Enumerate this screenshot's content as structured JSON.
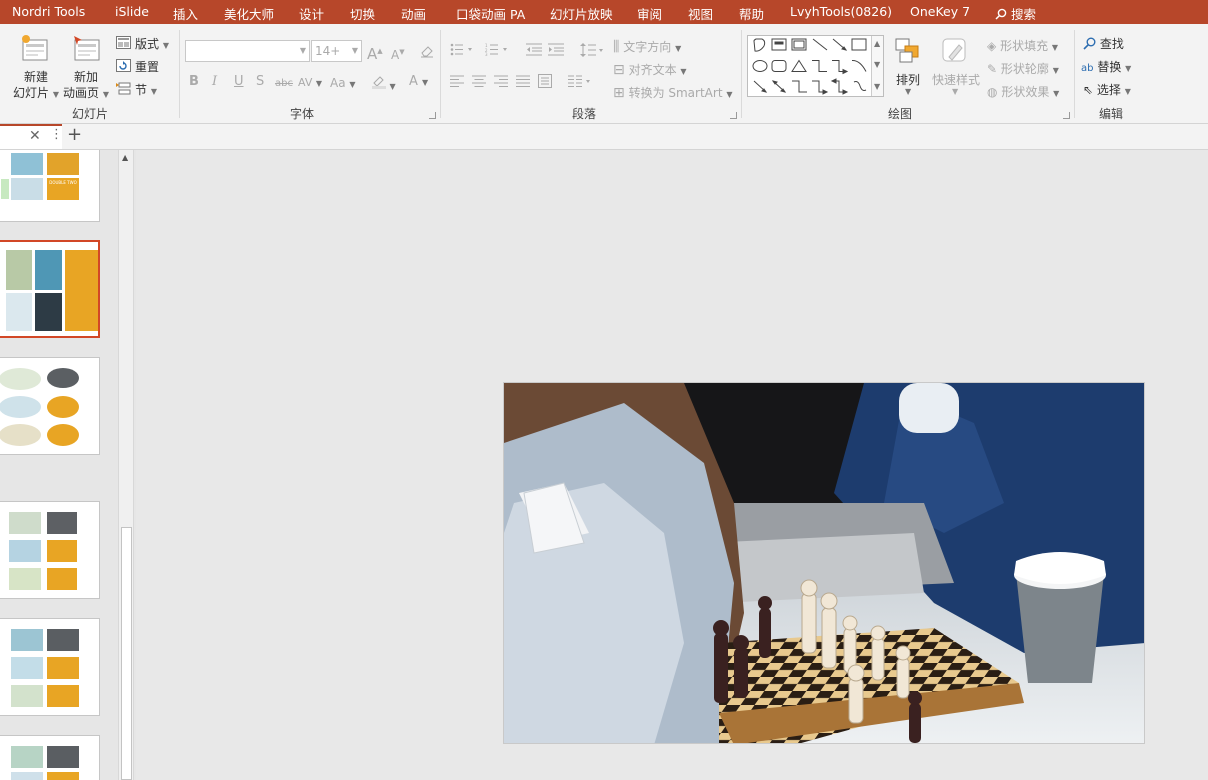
{
  "tabs": [
    "Nordri Tools",
    "iSlide",
    "插入",
    "美化大师",
    "设计",
    "切换",
    "动画",
    "口袋动画 PA",
    "幻灯片放映",
    "审阅",
    "视图",
    "帮助",
    "LvyhTools(0826)",
    "OneKey 7",
    "搜索"
  ],
  "slides_group": {
    "new_slide": [
      "新建",
      "幻灯片"
    ],
    "new_anim": [
      "新加",
      "动画页"
    ],
    "layout": "版式",
    "reset": "重置",
    "section": "节",
    "label": "幻灯片"
  },
  "font_group": {
    "font_name": "",
    "font_size": "14+",
    "bold": "B",
    "italic": "I",
    "underline": "U",
    "shadow": "S",
    "strike": "abc",
    "spacing": "AV",
    "case": "Aa",
    "grow": "A",
    "shrink": "A",
    "color": "A",
    "label": "字体"
  },
  "para_group": {
    "text_dir": "文字方向",
    "align_text": "对齐文本",
    "smartart": "转换为 SmartArt",
    "label": "段落"
  },
  "draw_group": {
    "arrange": "排列",
    "quick": "快速样式",
    "fill": "形状填充",
    "outline": "形状轮廓",
    "effect": "形状效果",
    "label": "绘图"
  },
  "edit_group": {
    "find": "查找",
    "replace": "替换",
    "select": "选择",
    "label": "编辑"
  },
  "thumb_text": "DOUBLE TWO"
}
